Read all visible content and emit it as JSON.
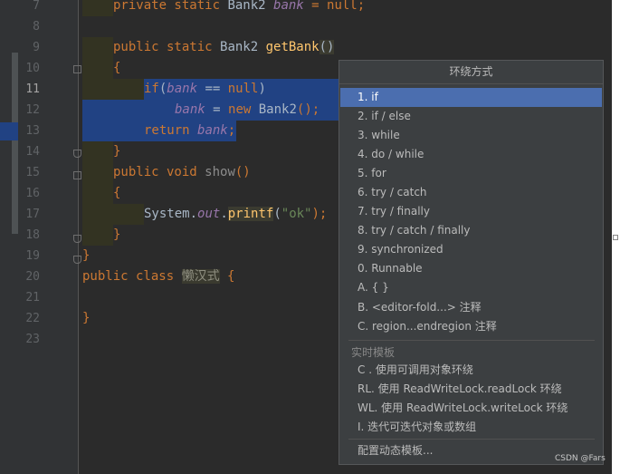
{
  "editor": {
    "line_numbers": [
      "7",
      "8",
      "9",
      "10",
      "11",
      "12",
      "13",
      "14",
      "15",
      "16",
      "17",
      "18",
      "19",
      "20",
      "21",
      "22",
      "23"
    ],
    "current_line": "11",
    "lines": {
      "l7": {
        "kw1": "private static ",
        "type": "Bank2 ",
        "field": "bank",
        "rest": " = null;"
      },
      "l9": {
        "kw1": "public static ",
        "type": "Bank2 ",
        "method": "getBank",
        "paren": "()"
      },
      "l10": {
        "brace": "{"
      },
      "l11": {
        "kw": "if",
        "open": "(",
        "field": "bank",
        "mid": " == ",
        "nul": "null",
        "close": ")"
      },
      "l12": {
        "field": "bank",
        "eq": " = ",
        "kw": "new ",
        "type": "Bank2",
        "rest": "();"
      },
      "l13": {
        "kw": "return ",
        "field": "bank",
        "rest": ";"
      },
      "l14": {
        "brace": "}"
      },
      "l15": {
        "kw": "public void ",
        "method": "show",
        "paren": "()"
      },
      "l16": {
        "brace": "{"
      },
      "l17": {
        "obj": "System.",
        "field": "out",
        "dot": ".",
        "method": "printf",
        "open": "(",
        "str": "\"ok\"",
        "close": ");"
      },
      "l18": {
        "brace": "}"
      },
      "l19": {
        "brace": "}"
      },
      "l20": {
        "kw": "public class ",
        "name": "懒汉式",
        "rest": " {"
      },
      "l22": {
        "brace": "}"
      }
    }
  },
  "popup": {
    "title": "环绕方式",
    "items": [
      "1. if",
      "2. if / else",
      "3. while",
      "4. do / while",
      "5. for",
      "6. try / catch",
      "7. try / finally",
      "8. try / catch / finally",
      "9. synchronized",
      "0. Runnable",
      "A. { }",
      "B. <editor-fold...> 注释",
      "C. region...endregion 注释"
    ],
    "selected_item": "1. if",
    "section_label": "实时模板",
    "template_items": [
      "C . 使用可调用对象环绕",
      "RL. 使用 ReadWriteLock.readLock 环绕",
      "WL. 使用 ReadWriteLock.writeLock 环绕",
      "I. 迭代可迭代对象或数组"
    ],
    "footer_item": "配置动态模板..."
  },
  "watermark": "CSDN @Fars",
  "colors": {
    "selection": "#214283",
    "popup_selection": "#4b6eaf",
    "keyword": "#cc7832",
    "method": "#ffc66d",
    "field": "#9876aa",
    "string": "#6a8759"
  }
}
